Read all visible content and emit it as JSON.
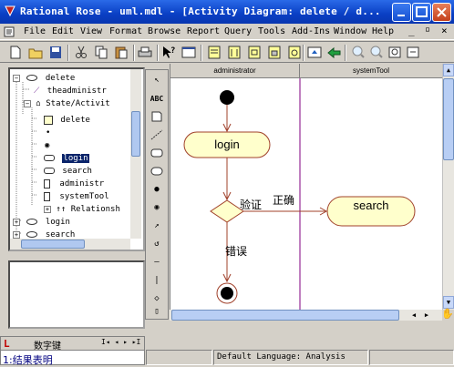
{
  "window": {
    "title": "Rational Rose - uml.mdl - [Activity Diagram: delete / d..."
  },
  "menu": [
    "File",
    "Edit",
    "View",
    "Format",
    "Browse",
    "Report",
    "Query",
    "Tools",
    "Add-Ins",
    "Window",
    "Help"
  ],
  "browser": {
    "items": [
      {
        "label": "delete",
        "depth": 1
      },
      {
        "label": "theadministr",
        "depth": 2
      },
      {
        "label": "State/Activit",
        "depth": 2
      },
      {
        "label": "delete",
        "depth": 3
      },
      {
        "label": "login",
        "depth": 3,
        "selected": true
      },
      {
        "label": "search",
        "depth": 3
      },
      {
        "label": "administr",
        "depth": 3
      },
      {
        "label": "systemTool",
        "depth": 3
      },
      {
        "label": "Relationsh",
        "depth": 3
      },
      {
        "label": "login",
        "depth": 1
      },
      {
        "label": "search",
        "depth": 1
      }
    ]
  },
  "diagram": {
    "swimlanes": [
      "administrator",
      "systemTool"
    ],
    "activities": {
      "login": "login",
      "search": "search"
    },
    "decision_label": "验证",
    "guard_yes": "正确",
    "guard_no": "错误"
  },
  "palette": {
    "text_tool": "ABC"
  },
  "log": {
    "title": "数字键",
    "nav": "I◂ ◂ ▸ ▸I",
    "line": "1:结果表明"
  },
  "status": {
    "language": "Default Language: Analysis"
  },
  "colors": {
    "activity_fill": "#ffffcc",
    "activity_stroke": "#a0402a",
    "titlebar": "#0a3fc4",
    "swimlane_line": "#800080"
  }
}
